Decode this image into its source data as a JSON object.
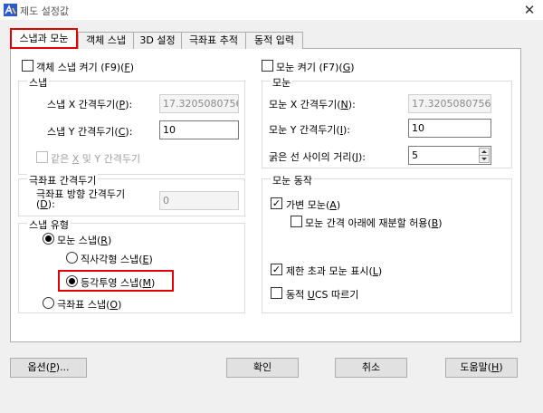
{
  "window": {
    "title": "제도 설정값",
    "close_glyph": "✕"
  },
  "tabs": [
    {
      "label": "스냅과 모눈",
      "active": true
    },
    {
      "label": "객체 스냅"
    },
    {
      "label": "3D 설정"
    },
    {
      "label": "극좌표 추적"
    },
    {
      "label": "동적 입력"
    }
  ],
  "snap": {
    "toggle": {
      "pre": "객체 스냅 켜기 (F9)(",
      "key": "F",
      "post": ")",
      "checked": false
    },
    "group_label": "스냅",
    "x_label": {
      "pre": "스냅 X 간격두기(",
      "key": "P",
      "post": "):"
    },
    "x_value": "17.3205080756",
    "y_label": {
      "pre": "스냅 Y 간격두기(",
      "key": "C",
      "post": "):"
    },
    "y_value": "10",
    "equal_label": {
      "pre": "같은 ",
      "key": "X",
      "post": " 및 Y 간격두기"
    }
  },
  "polar": {
    "group_label": "극좌표 간격두기",
    "dist_label_1": "극좌표 방향 간격두기",
    "dist_label_2": {
      "pre": "(",
      "key": "D",
      "post": "):"
    },
    "dist_value": "0"
  },
  "snap_type": {
    "group_label": "스냅 유형",
    "grid": {
      "pre": "모눈 스냅(",
      "key": "R",
      "post": ")"
    },
    "rect": {
      "pre": "직사각형 스냅(",
      "key": "E",
      "post": ")"
    },
    "iso": {
      "pre": "등각투영 스냅(",
      "key": "M",
      "post": ")"
    },
    "polar_snap": {
      "pre": "극좌표 스냅(",
      "key": "O",
      "post": ")"
    }
  },
  "grid": {
    "toggle": {
      "pre": "모눈 켜기 (F7)(",
      "key": "G",
      "post": ")",
      "checked": false
    },
    "group_label": "모눈",
    "x_label": {
      "pre": "모눈 X 간격두기(",
      "key": "N",
      "post": "):"
    },
    "x_value": "17.3205080756",
    "y_label": {
      "pre": "모눈 Y 간격두기(",
      "key": "I",
      "post": "):"
    },
    "y_value": "10",
    "major_label": {
      "pre": "굵은 선 사이의 거리(",
      "key": "J",
      "post": "):"
    },
    "major_value": "5"
  },
  "grid_behavior": {
    "group_label": "모눈 동작",
    "adaptive": {
      "pre": "가변 모눈(",
      "key": "A",
      "post": ")",
      "checked": true
    },
    "subdivide": {
      "pre": "모눈 간격 아래에 재분할 허용(",
      "key": "B",
      "post": ")",
      "checked": false
    },
    "beyond": {
      "pre": "제한 초과 모눈 표시(",
      "key": "L",
      "post": ")",
      "checked": true
    },
    "follow_ucs": {
      "pre": "동적 ",
      "key": "U",
      "post": "CS 따르기",
      "checked": false
    }
  },
  "buttons": {
    "options": {
      "pre": "옵션(",
      "key": "P",
      "post": ")..."
    },
    "ok": "확인",
    "cancel": "취소",
    "help": {
      "pre": "도움말(",
      "key": "H",
      "post": ")"
    }
  },
  "check_glyph": "✓"
}
